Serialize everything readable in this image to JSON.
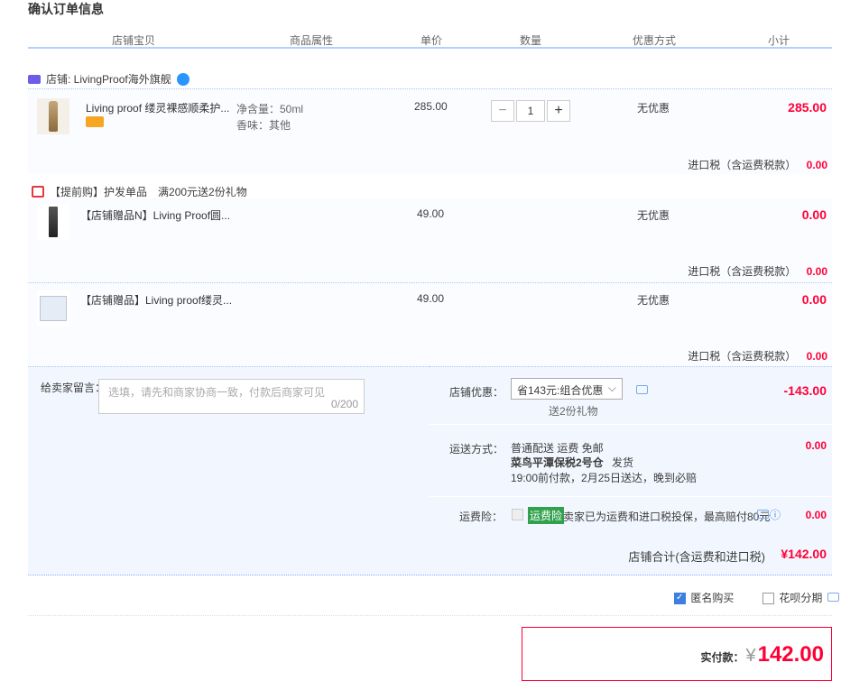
{
  "page_title": "确认订单信息",
  "columns": [
    "店铺宝贝",
    "商品属性",
    "单价",
    "数量",
    "优惠方式",
    "小计"
  ],
  "shop": {
    "label": "店铺: LivingProof海外旗舰"
  },
  "items": [
    {
      "name": "Living proof 缕灵裸感顺柔护...",
      "attr1": "净含量：50ml",
      "attr2": "香味：其他",
      "price": "285.00",
      "qty": "1",
      "discount": "无优惠",
      "subtotal": "285.00",
      "tax_label": "进口税（含运费税款）",
      "tax_value": "0.00"
    },
    {
      "name": "【店铺赠品N】Living Proof圆...",
      "price": "49.00",
      "discount": "无优惠",
      "subtotal": "0.00",
      "tax_label": "进口税（含运费税款）",
      "tax_value": "0.00"
    },
    {
      "name": "【店铺赠品】Living proof缕灵...",
      "price": "49.00",
      "discount": "无优惠",
      "subtotal": "0.00",
      "tax_label": "进口税（含运费税款）",
      "tax_value": "0.00"
    }
  ],
  "gift_promo": {
    "tag": "【提前购】护发单品",
    "text": "满200元送2份礼物"
  },
  "message": {
    "label": "给卖家留言：",
    "placeholder": "选填，请先和商家协商一致，付款后商家可见",
    "counter": "0/200"
  },
  "shop_discount": {
    "label": "店铺优惠：",
    "selected": "省143元:组合优惠",
    "note": "送2份礼物",
    "value": "-143.00"
  },
  "shipping": {
    "label": "运送方式：",
    "line1": "普通配送 运费 免邮",
    "line2": "菜鸟平潭保税2号仓",
    "line2b": "发货",
    "line3": "19:00前付款，2月25日送达，晚到必赔",
    "value": "0.00"
  },
  "insurance": {
    "label": "运费险：",
    "badge": "运费险",
    "text": "卖家已为运费和进口税投保，最高赔付80元",
    "value": "0.00"
  },
  "shop_total": {
    "label": "店铺合计(含运费和进口税)",
    "value": "¥142.00"
  },
  "options": {
    "anonymous": "匿名购买",
    "installment": "花呗分期"
  },
  "payment": {
    "label": "实付款：",
    "currency": "¥",
    "amount": "142.00"
  }
}
